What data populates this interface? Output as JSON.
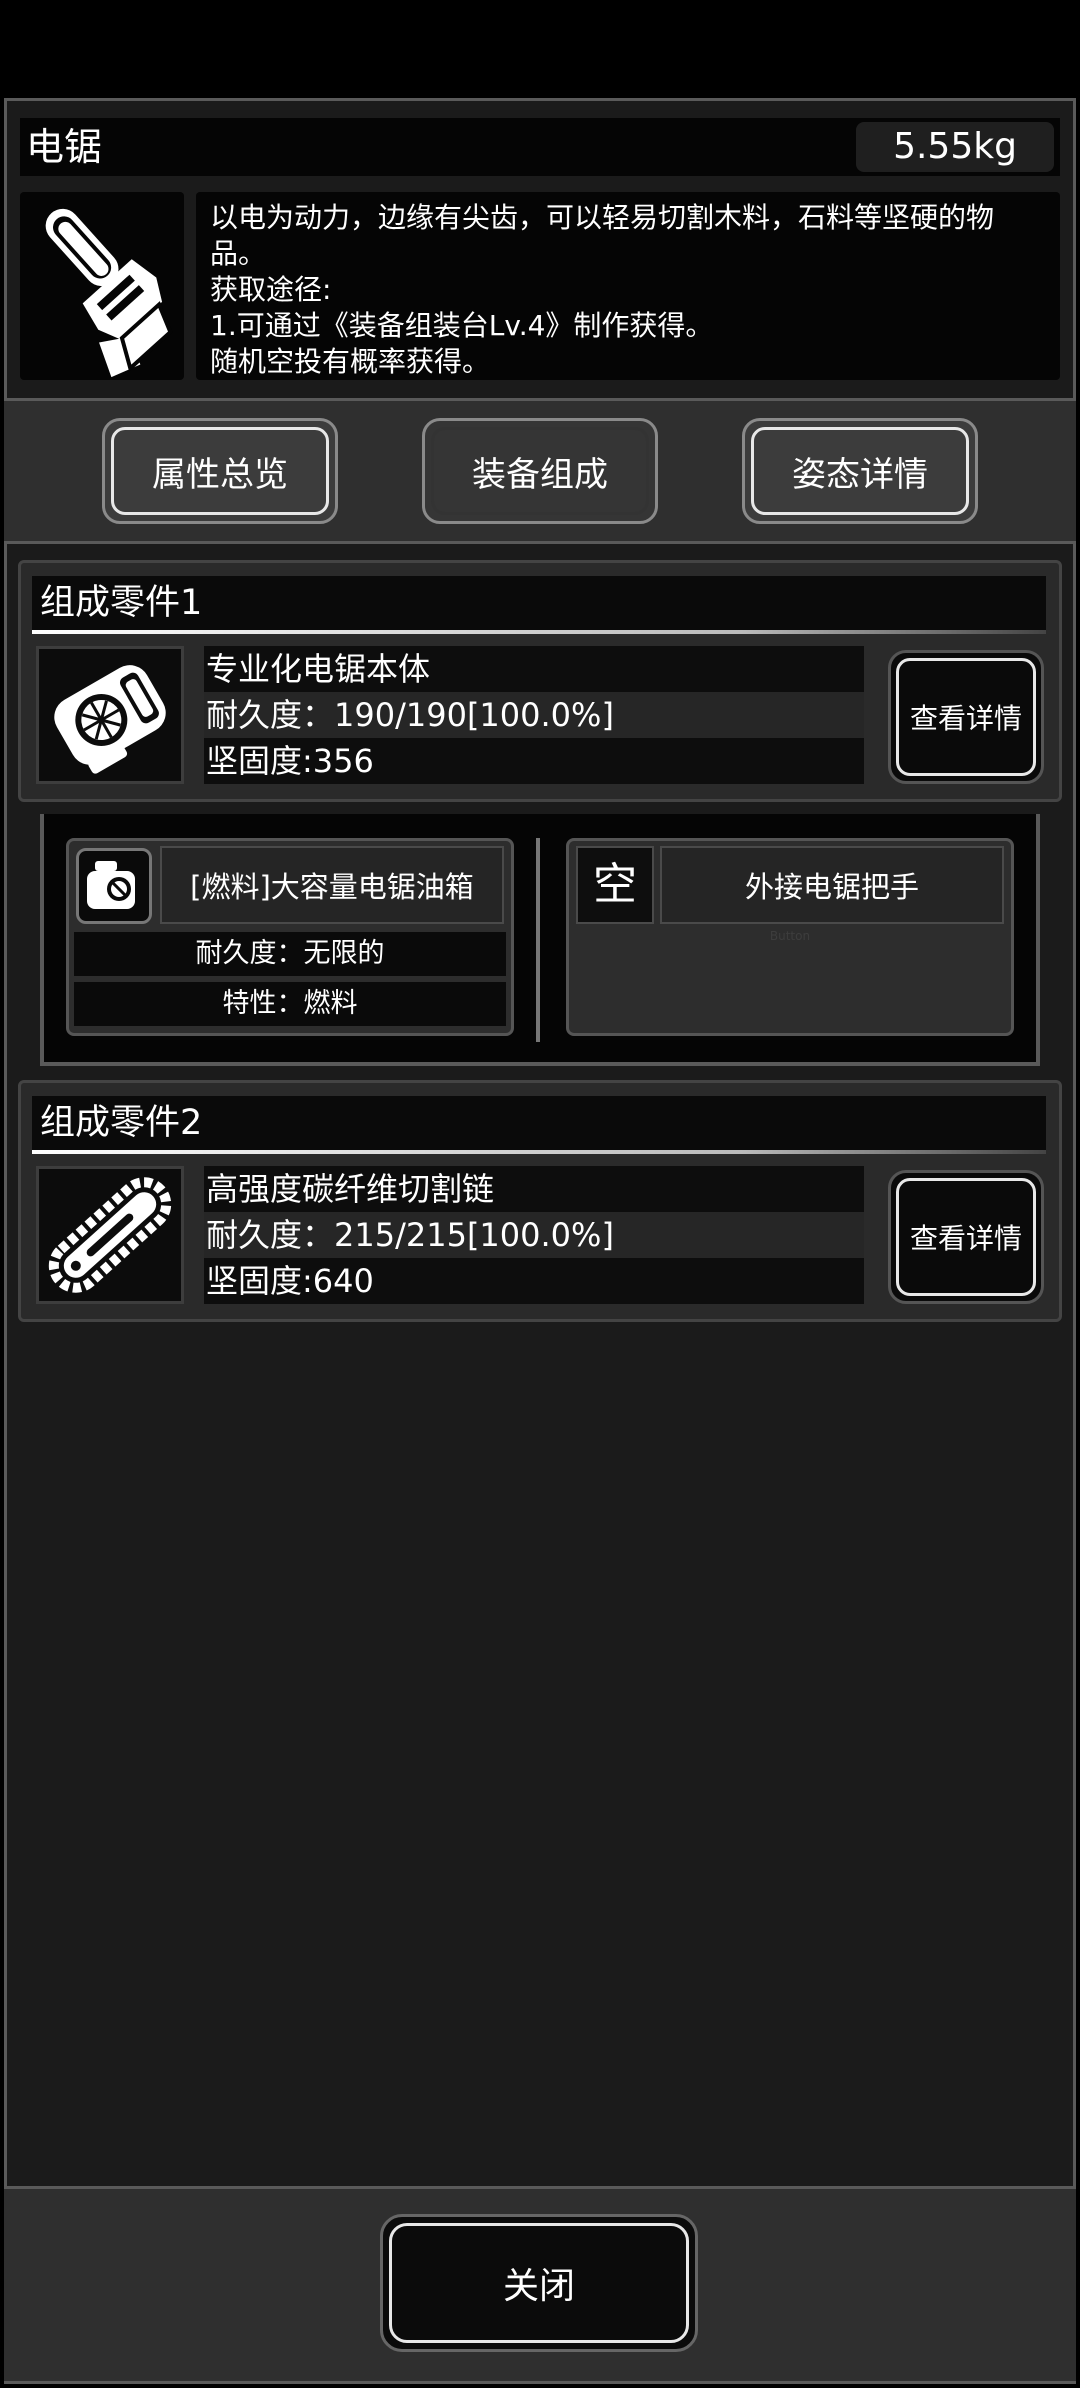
{
  "item": {
    "name": "电锯",
    "weight": "5.55kg",
    "icon": "chainsaw-icon",
    "description": [
      "以电为动力，边缘有尖齿，可以轻易切割木料，石料等坚硬的物",
      "品。",
      "获取途径:",
      "1.可通过《装备组装台Lv.4》制作获得。",
      "随机空投有概率获得。"
    ]
  },
  "tabs": [
    {
      "label": "属性总览",
      "active": false
    },
    {
      "label": "装备组成",
      "active": true
    },
    {
      "label": "姿态详情",
      "active": false
    }
  ],
  "parts": [
    {
      "header": "组成零件1",
      "icon": "chainsaw-body-icon",
      "name": "专业化电锯本体",
      "durability": "耐久度：190/190[100.0%]",
      "hardness": "坚固度:356",
      "detail_label": "查看详情"
    },
    {
      "header": "组成零件2",
      "icon": "chain-blade-icon",
      "name": "高强度碳纤维切割链",
      "durability": "耐久度：215/215[100.0%]",
      "hardness": "坚固度:640",
      "detail_label": "查看详情"
    }
  ],
  "subparts": {
    "slot_a": {
      "icon": "fuel-tank-icon",
      "name": "[燃料]大容量电锯油箱",
      "durability": "耐久度：无限的",
      "trait": "特性：燃料"
    },
    "slot_b": {
      "empty_mark": "空",
      "name": "外接电锯把手",
      "ghost_text": "Button"
    }
  },
  "footer": {
    "close_label": "关闭"
  }
}
